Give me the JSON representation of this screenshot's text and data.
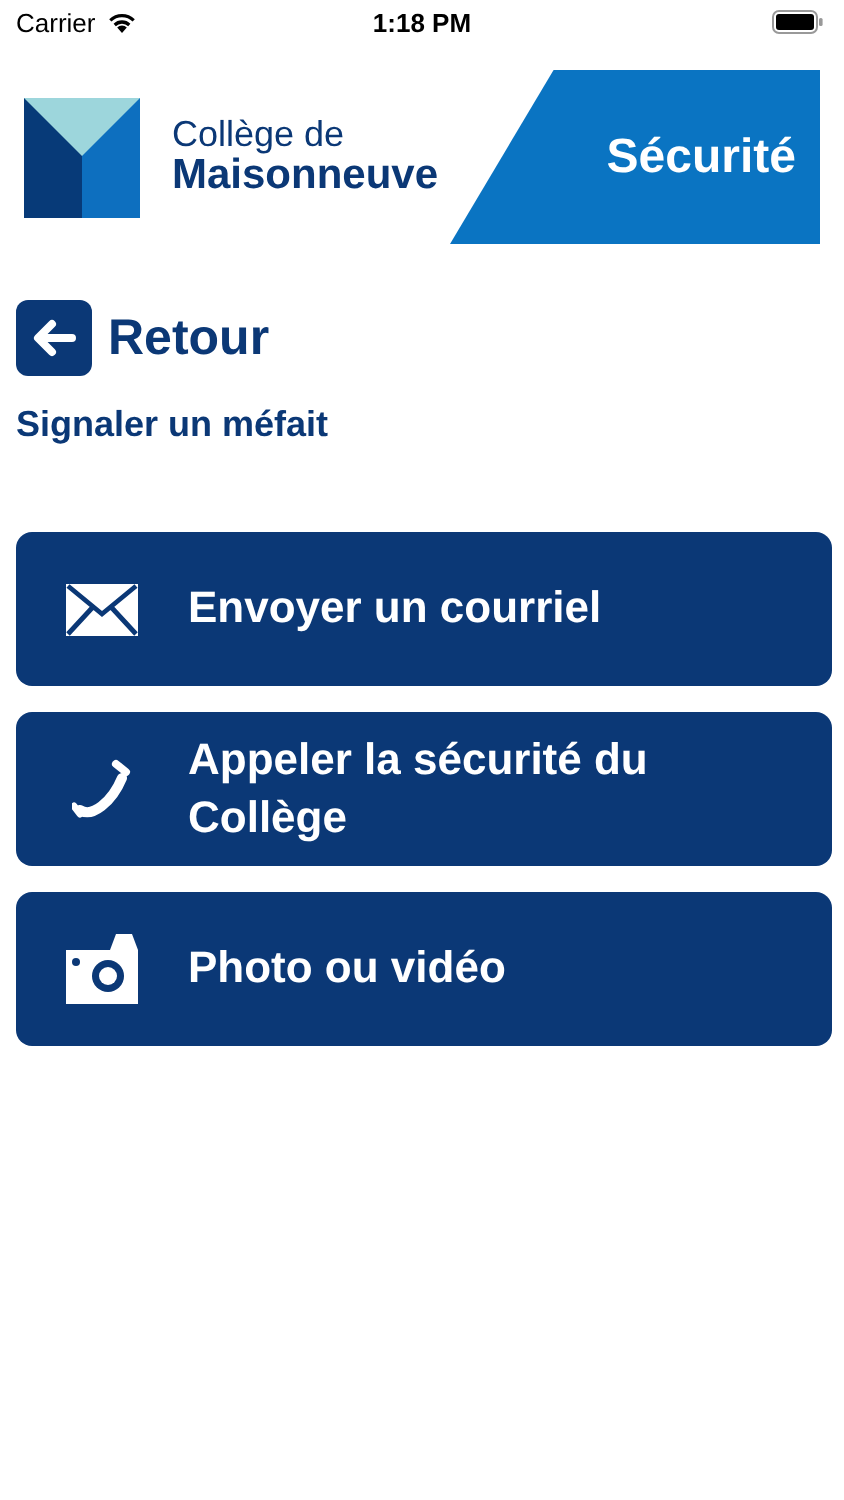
{
  "status_bar": {
    "carrier": "Carrier",
    "time": "1:18 PM"
  },
  "header": {
    "logo_line_1": "Collège de",
    "logo_line_2": "Maisonneuve",
    "banner": "Sécurité"
  },
  "back_button": {
    "label": "Retour"
  },
  "subtitle": "Signaler un méfait",
  "actions": [
    {
      "kind": "email",
      "label": "Envoyer un courriel"
    },
    {
      "kind": "phone",
      "label": "Appeler la sécurité du Collège"
    },
    {
      "kind": "camera",
      "label": "Photo ou vidéo"
    }
  ]
}
